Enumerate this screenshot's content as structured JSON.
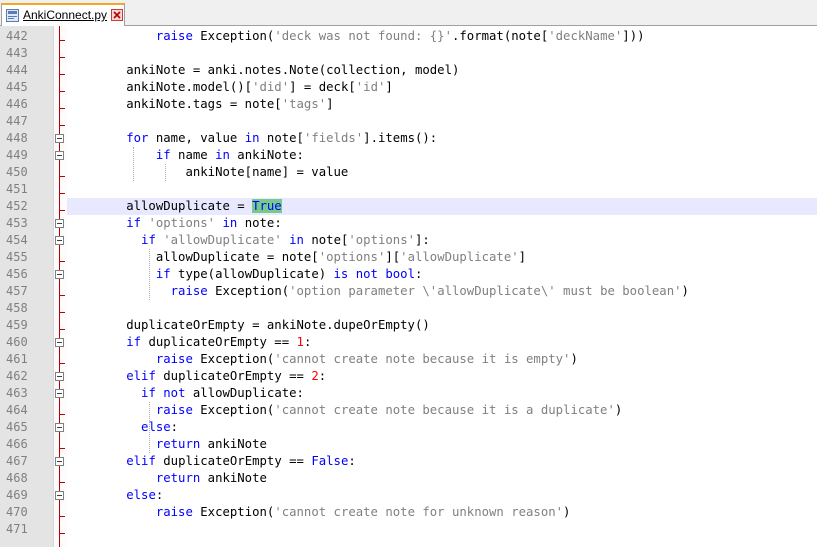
{
  "tab": {
    "label": "AnkiConnect.py",
    "icon": "python-file-icon"
  },
  "colors": {
    "keyword": "#0000ff",
    "string": "#808080",
    "number": "#ff0000",
    "match_highlight": "#77c98c",
    "current_line": "#e8e8ff",
    "fold_line": "#c00000"
  },
  "line_numbers": [
    "442",
    "443",
    "444",
    "445",
    "446",
    "447",
    "448",
    "449",
    "450",
    "451",
    "452",
    "453",
    "454",
    "455",
    "456",
    "457",
    "458",
    "459",
    "460",
    "461",
    "462",
    "463",
    "464",
    "465",
    "466",
    "467",
    "468",
    "469",
    "470",
    "471"
  ],
  "current_line": "452",
  "code": [
    "raise Exception('deck was not found: {}'.format(note['deckName']))",
    "",
    "ankiNote = anki.notes.Note(collection, model)",
    "ankiNote.model()['did'] = deck['id']",
    "ankiNote.tags = note['tags']",
    "",
    "for name, value in note['fields'].items():",
    "if name in ankiNote:",
    "ankiNote[name] = value",
    "",
    "allowDuplicate = True",
    "if 'options' in note:",
    "if 'allowDuplicate' in note['options']:",
    "allowDuplicate = note['options']['allowDuplicate']",
    "if type(allowDuplicate) is not bool:",
    "raise Exception('option parameter \\'allowDuplicate\\' must be boolean')",
    "",
    "duplicateOrEmpty = ankiNote.dupeOrEmpty()",
    "if duplicateOrEmpty == 1:",
    "raise Exception('cannot create note because it is empty')",
    "elif duplicateOrEmpty == 2:",
    "if not allowDuplicate:",
    "raise Exception('cannot create note because it is a duplicate')",
    "else:",
    "return ankiNote",
    "elif duplicateOrEmpty == False:",
    "return ankiNote",
    "else:",
    "raise Exception('cannot create note for unknown reason')",
    ""
  ]
}
